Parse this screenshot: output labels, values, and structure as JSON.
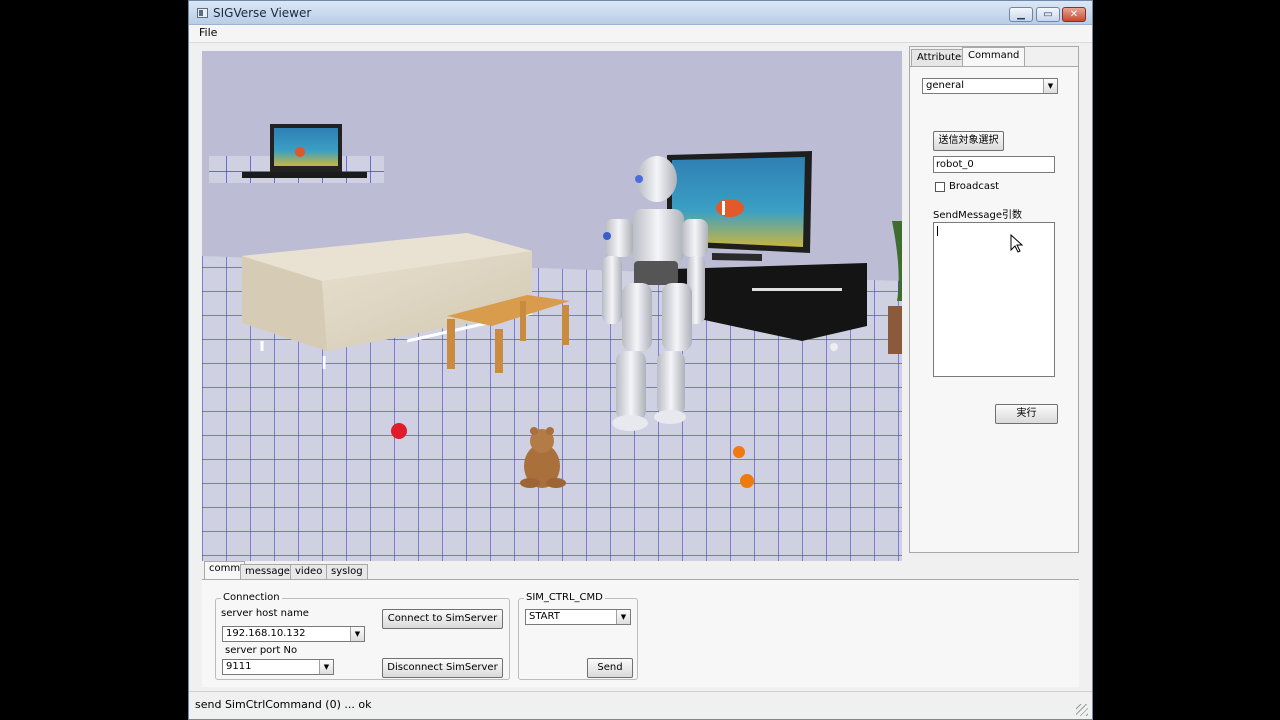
{
  "window": {
    "title": "SIGVerse Viewer"
  },
  "menu": {
    "file": "File"
  },
  "side_panel": {
    "tabs": [
      {
        "label": "Attributes"
      },
      {
        "label": "Command"
      }
    ],
    "mode_select": {
      "value": "general"
    },
    "select_target_button": "送信対象選択",
    "target_field": {
      "value": "robot_0"
    },
    "broadcast": {
      "label": "Broadcast",
      "checked": false
    },
    "send_message_label": "SendMessage引数",
    "execute_button": "実行"
  },
  "bottom_panel": {
    "tabs": [
      {
        "label": "comm"
      },
      {
        "label": "messages"
      },
      {
        "label": "video"
      },
      {
        "label": "syslog"
      }
    ],
    "connection": {
      "group_label": "Connection",
      "host_label": "server host name",
      "host_value": "192.168.10.132",
      "port_label": "server port No",
      "port_value": "9111",
      "connect_button": "Connect to SimServer",
      "disconnect_button": "Disconnect SimServer"
    },
    "sim_ctrl": {
      "group_label": "SIM_CTRL_CMD",
      "command_value": "START",
      "send_button": "Send"
    }
  },
  "status_bar": {
    "text": "send SimCtrlCommand (0) ... ok"
  },
  "icons": {
    "window_controls": [
      "minimize-icon",
      "maximize-icon",
      "close-icon"
    ],
    "dropdown": "chevron-down-icon",
    "cursor": "mouse-pointer-icon"
  },
  "colors": {
    "floor_grid": "#2a2ad0",
    "wall": "#bcbcd4",
    "floor": "#cfd0e2"
  }
}
